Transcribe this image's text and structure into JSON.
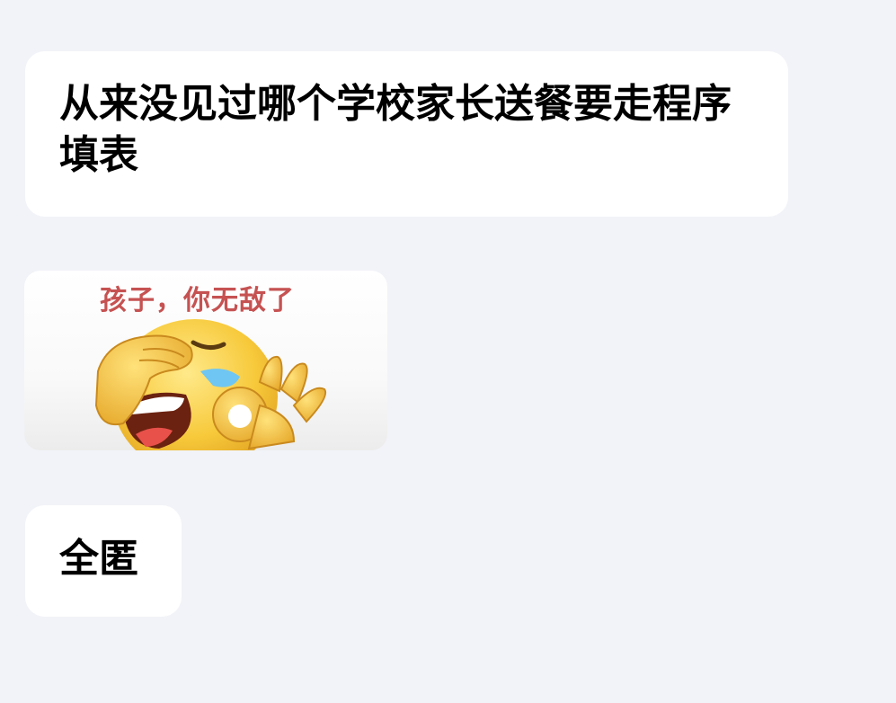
{
  "messages": [
    {
      "type": "text",
      "text": "从来没见过哪个学校家长送餐要走程序填表"
    },
    {
      "type": "sticker",
      "icon": "facepalm-laughing-ok-emoji",
      "caption": "孩子，你无敌了"
    },
    {
      "type": "text",
      "text": "全匿"
    }
  ],
  "colors": {
    "background": "#f2f3f8",
    "bubble": "#ffffff",
    "caption": "#c65252",
    "emoji": "#f7c93a"
  }
}
